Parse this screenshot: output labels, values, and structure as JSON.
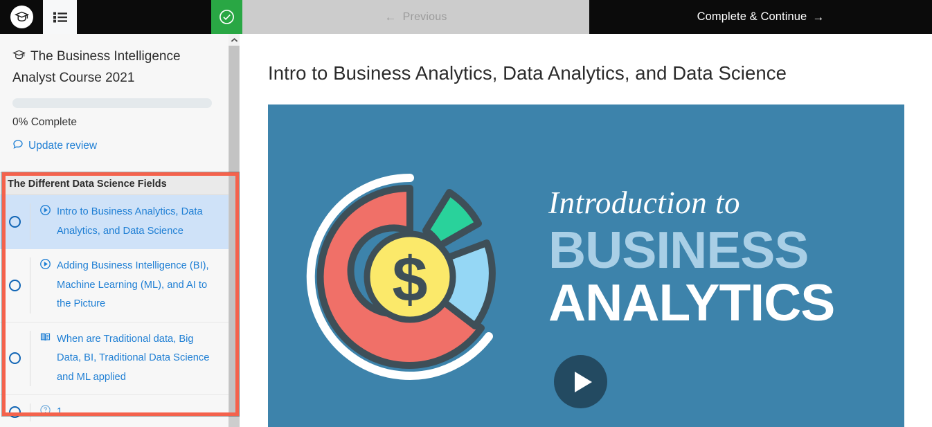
{
  "topbar": {
    "brand_icon": "graduation-cap-icon",
    "menu_icon": "list-menu-icon",
    "complete_icon": "check-circle-icon",
    "previous_label": "Previous",
    "previous_arrow": "←",
    "next_label": "Complete & Continue",
    "next_arrow": "→",
    "colors": {
      "bar_bg": "#0b0b0b",
      "green": "#29a744",
      "previous_bg": "#cccccc",
      "previous_text": "#9b9b9b"
    }
  },
  "sidebar": {
    "course_title": "The Business Intelligence Analyst Course 2021",
    "course_icon": "graduation-cap-icon",
    "progress_percent": 0,
    "progress_label": "0% Complete",
    "update_review_label": "Update review",
    "update_review_icon": "comment-icon",
    "section_title": "The Different Data Science Fields",
    "scroll_up_icon": "chevron-up-icon",
    "lessons": [
      {
        "label": "Intro to Business Analytics, Data Analytics, and Data Science",
        "icon": "play-circle-icon",
        "selected": true,
        "completed": false
      },
      {
        "label": "Adding Business Intelligence (BI), Machine Learning (ML), and AI to the Picture",
        "icon": "play-circle-icon",
        "selected": false,
        "completed": false
      },
      {
        "label": "When are Traditional data, Big Data, BI, Traditional Data Science and ML applied",
        "icon": "book-icon",
        "selected": false,
        "completed": false
      },
      {
        "label": "1",
        "icon": "question-circle-icon",
        "selected": false,
        "completed": false
      }
    ],
    "colors": {
      "selected_bg": "#cfe2f8",
      "link": "#1f7fd4",
      "radio_border": "#1165b5",
      "section_header_bg": "#eaeaea"
    }
  },
  "annotation": {
    "highlight_color": "#f4624c"
  },
  "main": {
    "lecture_title": "Intro to Business Analytics, Data Analytics, and Data Science",
    "video": {
      "play_icon": "play-triangle-icon",
      "background_color": "#3d83ab",
      "text_line1": "Introduction to",
      "text_line2": "BUSINESS",
      "text_line3": "ANALYTICS",
      "text_line2_color": "#a9cfe6",
      "text_line3_color": "#ffffff",
      "graphic": {
        "name": "donut-chart-with-dollar-coin",
        "slices": [
          {
            "name": "red-slice",
            "color": "#f07068"
          },
          {
            "name": "green-slice",
            "color": "#29d29b"
          },
          {
            "name": "light-blue-slice",
            "color": "#95d7f5"
          }
        ],
        "center_coin_color": "#fbe96a",
        "center_symbol": "$",
        "outline_color": "#3e4f58"
      }
    }
  }
}
